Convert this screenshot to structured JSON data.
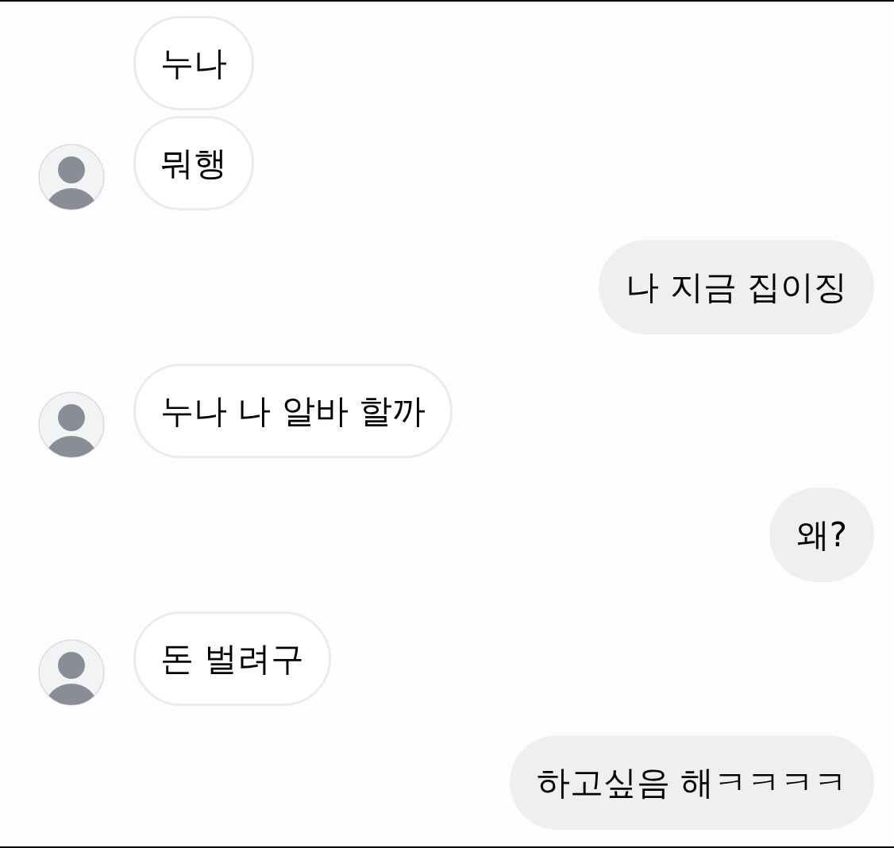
{
  "messages": [
    {
      "kind": "received",
      "text": "누나",
      "show_avatar": false
    },
    {
      "kind": "received",
      "text": "뭐행",
      "show_avatar": true
    },
    {
      "kind": "sent",
      "text": "나 지금 집이징"
    },
    {
      "kind": "received",
      "text": "누나 나 알바 할까",
      "show_avatar": true
    },
    {
      "kind": "sent",
      "text": "왜?"
    },
    {
      "kind": "received",
      "text": "돈 벌려구",
      "show_avatar": true
    },
    {
      "kind": "sent",
      "text": "하고싶음 해ㅋㅋㅋㅋ"
    }
  ]
}
